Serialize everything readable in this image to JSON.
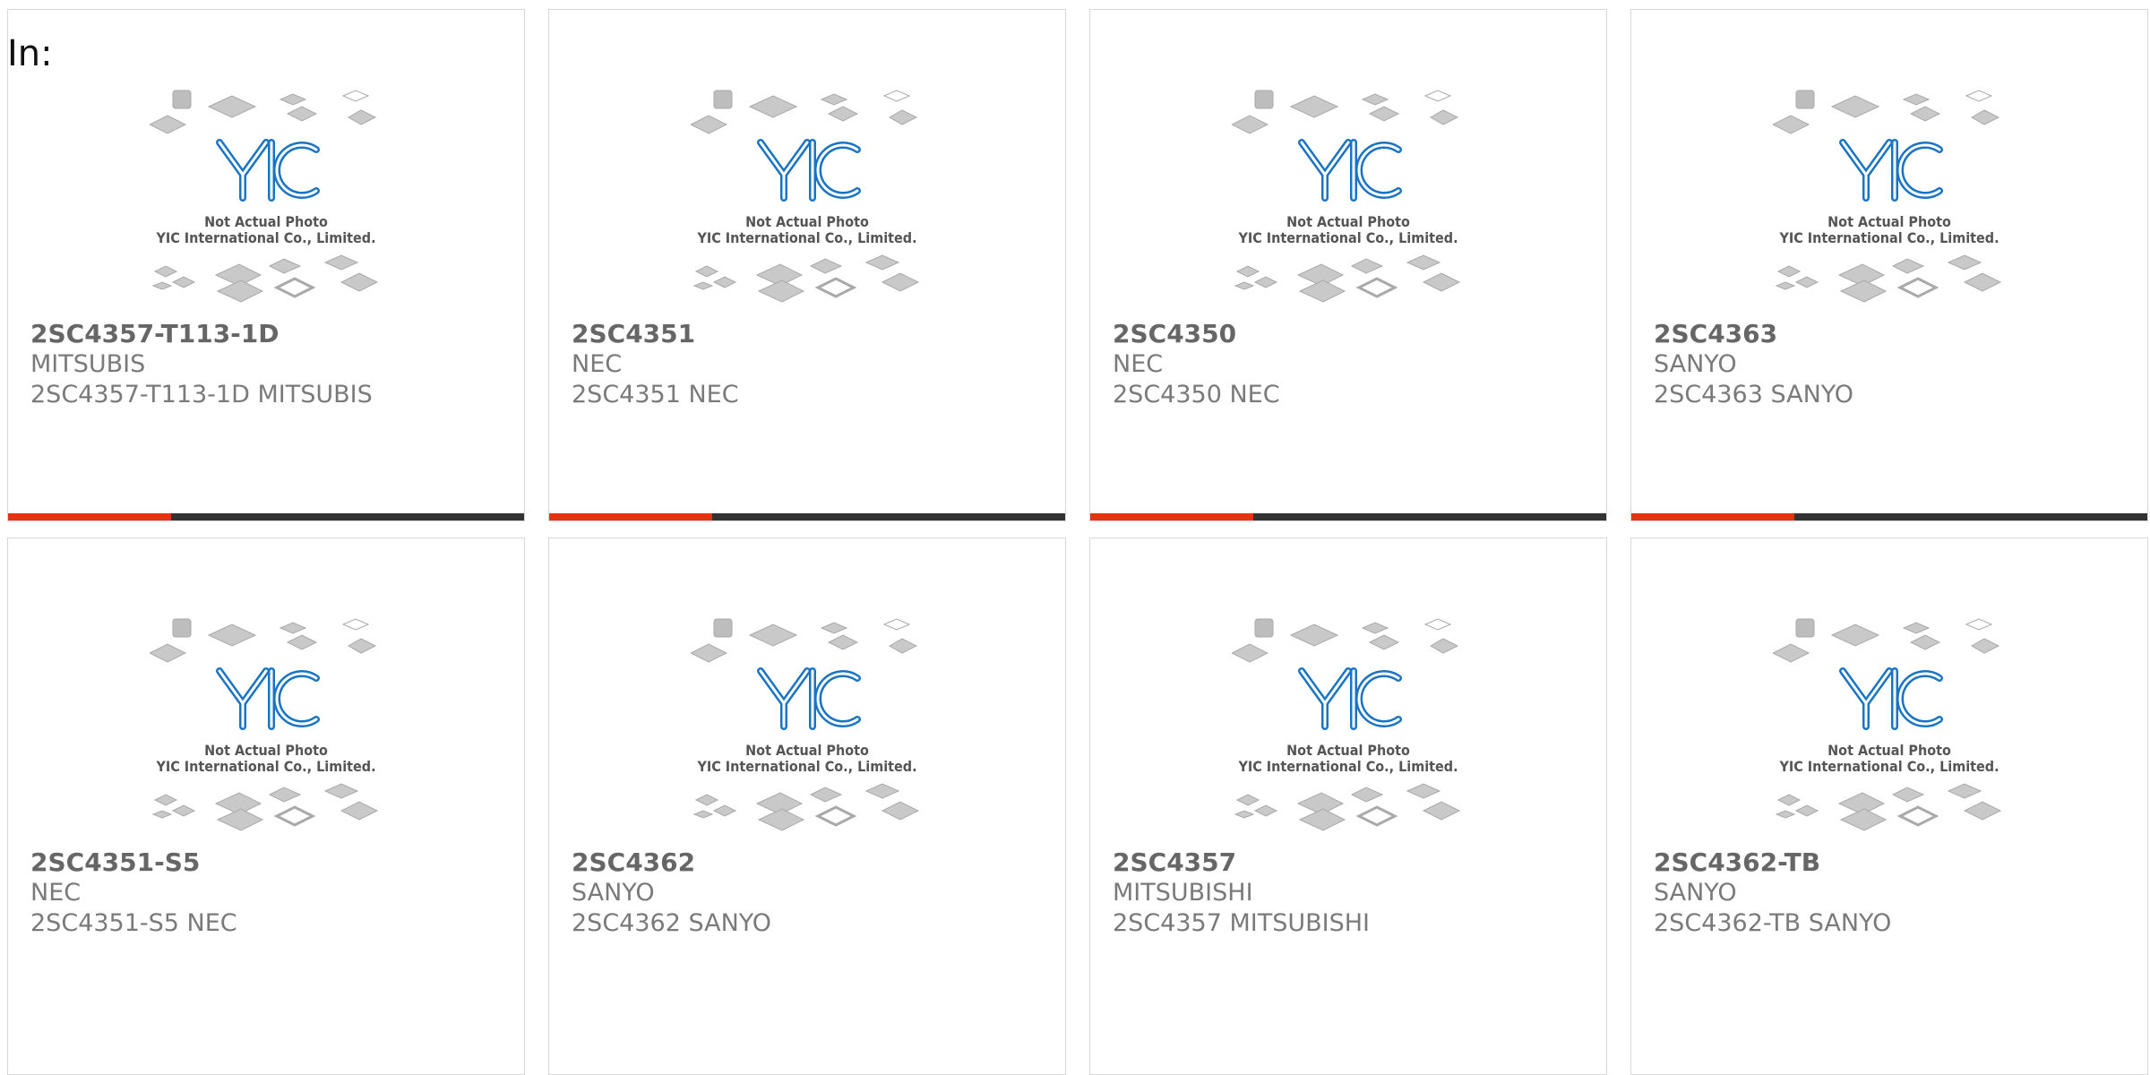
{
  "page": {
    "label": "In:"
  },
  "watermark": {
    "brand": "YIC",
    "line1": "Not Actual Photo",
    "line2": "YIC International Co., Limited."
  },
  "colors": {
    "accent": "#e53312",
    "bar": "#333333",
    "logo": "#1a74c2"
  },
  "products": [
    {
      "part": "2SC4357-T113-1D",
      "manufacturer": "MITSUBIS",
      "description": "2SC4357-T113-1D MITSUBIS"
    },
    {
      "part": "2SC4351",
      "manufacturer": "NEC",
      "description": "2SC4351 NEC"
    },
    {
      "part": "2SC4350",
      "manufacturer": "NEC",
      "description": "2SC4350 NEC"
    },
    {
      "part": "2SC4363",
      "manufacturer": "SANYO",
      "description": "2SC4363 SANYO"
    },
    {
      "part": "2SC4351-S5",
      "manufacturer": "NEC",
      "description": "2SC4351-S5 NEC"
    },
    {
      "part": "2SC4362",
      "manufacturer": "SANYO",
      "description": "2SC4362 SANYO"
    },
    {
      "part": "2SC4357",
      "manufacturer": "MITSUBISHI",
      "description": "2SC4357 MITSUBISHI"
    },
    {
      "part": "2SC4362-TB",
      "manufacturer": "SANYO",
      "description": "2SC4362-TB SANYO"
    }
  ]
}
